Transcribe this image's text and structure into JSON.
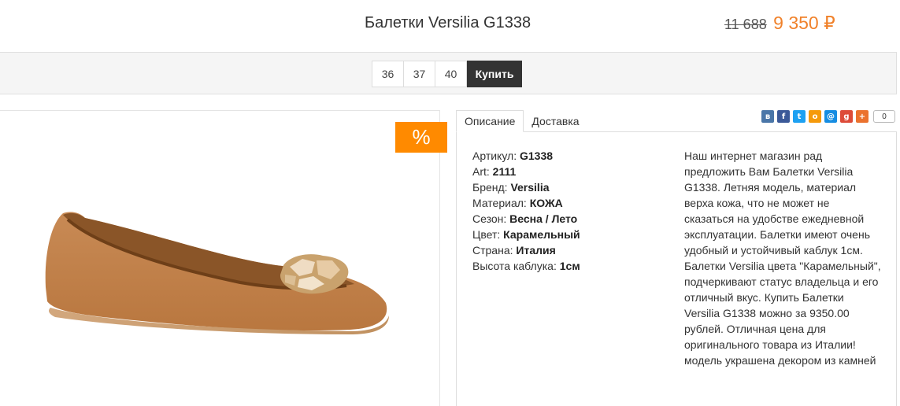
{
  "header": {
    "title": "Балетки Versilia G1338",
    "old_price": "11 688",
    "new_price": "9 350 ₽"
  },
  "sizes": [
    "36",
    "37",
    "40"
  ],
  "buy_label": "Купить",
  "badge": "%",
  "tabs": [
    "Описание",
    "Доставка"
  ],
  "social": {
    "icons": [
      "vk-icon",
      "facebook-icon",
      "twitter-icon",
      "odnoklassniki-icon",
      "mail-icon",
      "google-plus-icon",
      "plus-icon"
    ],
    "count": "0"
  },
  "specs": [
    {
      "label": "Артикул:",
      "value": "G1338"
    },
    {
      "label": "Art:",
      "value": "2111"
    },
    {
      "label": "Бренд:",
      "value": "Versilia"
    },
    {
      "label": "Материал:",
      "value": "КОЖА"
    },
    {
      "label": "Сезон:",
      "value": "Весна / Лето"
    },
    {
      "label": "Цвет:",
      "value": "Карамельный"
    },
    {
      "label": "Страна:",
      "value": "Италия"
    },
    {
      "label": "Высота каблука:",
      "value": "1см"
    }
  ],
  "description": "Наш интернет магазин рад предложить Вам Балетки Versilia G1338. Летняя модель, материал верха кожа, что не может не сказаться на удобстве ежедневной эксплуатации. Балетки имеют очень удобный и устойчивый каблук 1см. Балетки Versilia цвета \"Карамельный\", подчеркивают статус владельца и его отличный вкус. Купить Балетки Versilia G1338 можно за 9350.00 рублей. Отличная цена для оригинального товара из Италии! модель украшена декором из камней",
  "colors": {
    "accent": "#ff8a00",
    "price": "#f0812a",
    "buy_button": "#333333"
  }
}
